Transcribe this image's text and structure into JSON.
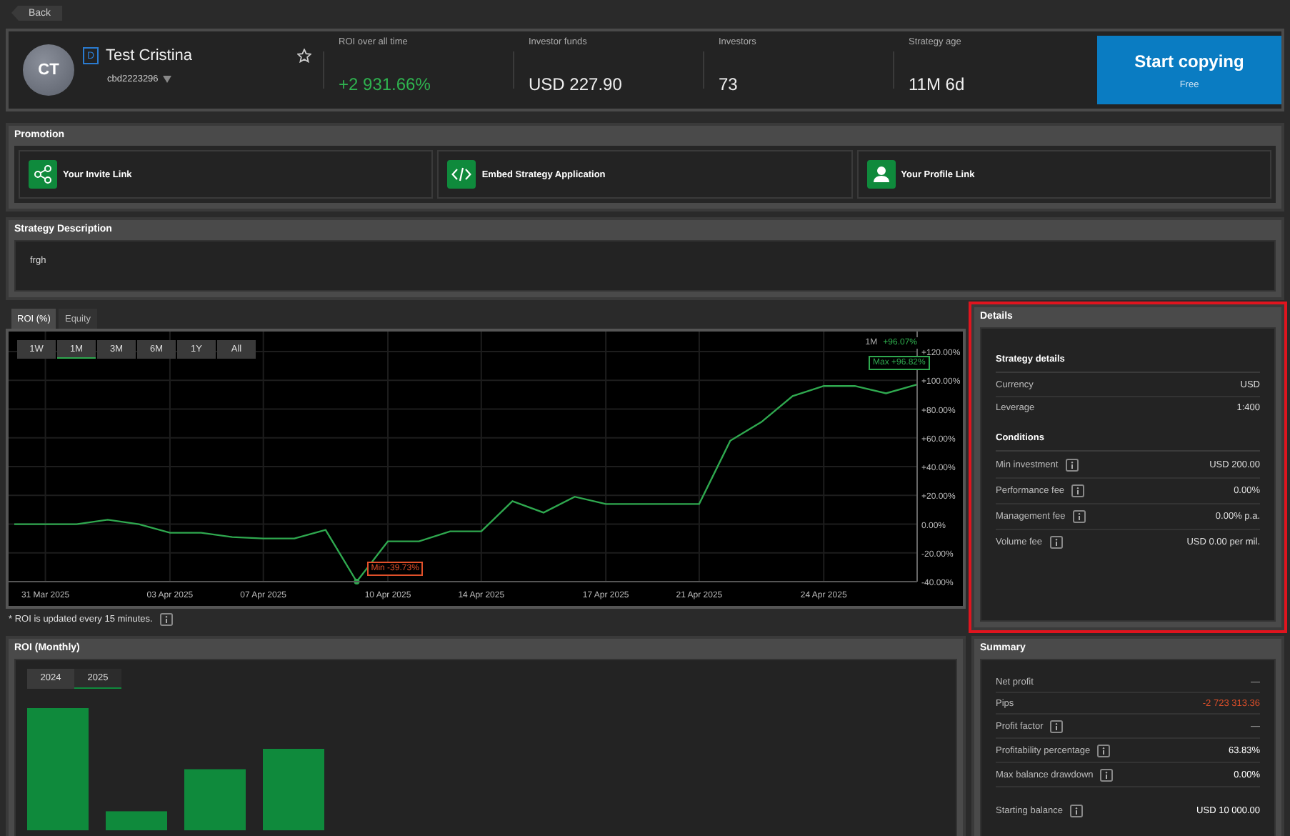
{
  "back_button": {
    "label": "Back"
  },
  "profile": {
    "initials": "CT",
    "badge": "D",
    "name": "Test Cristina",
    "account": "cbd2223296",
    "favorite": false
  },
  "stats": [
    {
      "label": "ROI over all time",
      "value": "+2 931.66%",
      "kind": "positive"
    },
    {
      "label": "Investor funds",
      "value": "USD 227.90",
      "kind": "plain"
    },
    {
      "label": "Investors",
      "value": "73",
      "kind": "plain"
    },
    {
      "label": "Strategy age",
      "value": "11M 6d",
      "kind": "plain"
    }
  ],
  "start_button": {
    "label": "Start copying",
    "sublabel": "Free"
  },
  "promotion": {
    "title": "Promotion",
    "items": [
      {
        "kind": "share",
        "label": "Your Invite Link"
      },
      {
        "kind": "code",
        "label": "Embed Strategy Application"
      },
      {
        "kind": "user",
        "label": "Your Profile Link"
      }
    ]
  },
  "description": {
    "title": "Strategy Description",
    "text": "frgh"
  },
  "chart_tabs": [
    {
      "label": "ROI (%)",
      "selected": true
    },
    {
      "label": "Equity",
      "selected": false
    }
  ],
  "ranges": [
    {
      "label": "1W",
      "selected": false
    },
    {
      "label": "1M",
      "selected": true
    },
    {
      "label": "3M",
      "selected": false
    },
    {
      "label": "6M",
      "selected": false
    },
    {
      "label": "1Y",
      "selected": false
    },
    {
      "label": "All",
      "selected": false
    }
  ],
  "legend": {
    "period": "1M",
    "value": "+96.07%"
  },
  "roi_chart": {
    "chart_data": {
      "type": "line",
      "grid": true,
      "ylim": [
        -40,
        120
      ],
      "categories": [
        null,
        "31 Mar 2025",
        null,
        null,
        null,
        "03 Apr 2025",
        null,
        null,
        "07 Apr 2025",
        null,
        null,
        null,
        "10 Apr 2025",
        null,
        null,
        "14 Apr 2025",
        null,
        null,
        null,
        "17 Apr 2025",
        null,
        null,
        "21 Apr 2025",
        null,
        null,
        null,
        "24 Apr 2025",
        null,
        null,
        null
      ],
      "yticks": [
        {
          "value": 120,
          "label": "+120.00%"
        },
        {
          "value": 100,
          "label": "+100.00%"
        },
        {
          "value": 80,
          "label": "+80.00%"
        },
        {
          "value": 60,
          "label": "+60.00%"
        },
        {
          "value": 40,
          "label": "+40.00%"
        },
        {
          "value": 20,
          "label": "+20.00%"
        },
        {
          "value": 0,
          "label": "0.00%"
        },
        {
          "value": -20,
          "label": "-20.00%"
        },
        {
          "value": -40,
          "label": "-40.00%"
        }
      ],
      "series": [
        {
          "color": "#2fa84f",
          "values": [
            0,
            0,
            0,
            3,
            0,
            -6,
            -6,
            -9,
            -10,
            -10,
            -4,
            -40,
            -12,
            -12,
            -5,
            -5,
            16,
            8,
            19,
            14,
            14,
            14,
            14,
            58,
            71,
            89,
            96,
            96,
            91,
            97
          ]
        }
      ],
      "annotations": [
        "Min -39.73%",
        "Max +96.82%"
      ]
    }
  },
  "chart_note": {
    "text": "* ROI is updated every 15 minutes."
  },
  "details": {
    "title": "Details",
    "highlighted": true,
    "sections": [
      {
        "heading": "Strategy details",
        "rows": [
          {
            "label": "Currency",
            "value": "USD",
            "info": false
          },
          {
            "label": "Leverage",
            "value": "1:400",
            "info": false
          }
        ]
      },
      {
        "heading": "Conditions",
        "rows": [
          {
            "label": "Min investment",
            "value": "USD 200.00",
            "info": true
          },
          {
            "label": "Performance fee",
            "value": "0.00%",
            "info": true
          },
          {
            "label": "Management fee",
            "value": "0.00% p.a.",
            "info": true
          },
          {
            "label": "Volume fee",
            "value": "USD 0.00 per mil.",
            "info": true
          }
        ]
      }
    ]
  },
  "monthly": {
    "title": "ROI (Monthly)",
    "tabs": [
      {
        "label": "2024",
        "selected": false
      },
      {
        "label": "2025",
        "selected": true
      }
    ]
  },
  "summary": {
    "title": "Summary",
    "rows": [
      {
        "label": "Net profit",
        "value": "—",
        "info": false,
        "kind": "plain"
      },
      {
        "label": "Pips",
        "value": "-2 723 313.36",
        "info": false,
        "kind": "negative"
      },
      {
        "label": "Profit factor",
        "value": "—",
        "info": true,
        "kind": "plain"
      },
      {
        "label": "Profitability percentage",
        "value": "63.83%",
        "info": true,
        "kind": "strong"
      },
      {
        "label": "Max balance drawdown",
        "value": "0.00%",
        "info": true,
        "kind": "strong"
      },
      {
        "label": "Starting balance",
        "value": "USD 10 000.00",
        "info": true,
        "kind": "strong"
      }
    ]
  }
}
